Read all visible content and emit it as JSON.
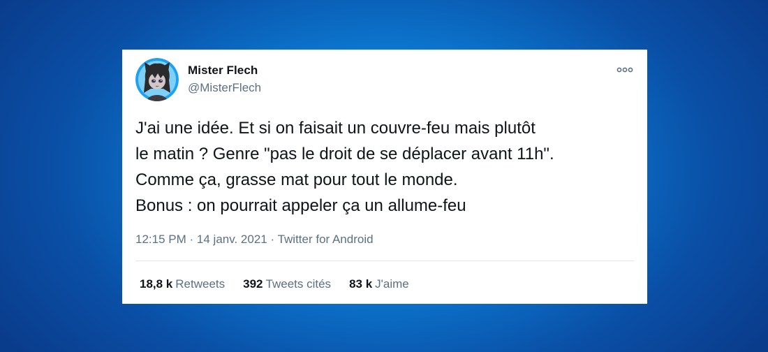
{
  "tweet": {
    "author_name": "Mister Flech",
    "author_handle": "@MisterFlech",
    "text": "J'ai une idée. Et si on faisait un couvre-feu mais plutôt\nle matin ? Genre \"pas le droit de se déplacer avant 11h\".\nComme ça, grasse mat pour tout le monde.\nBonus : on pourrait appeler ça un allume-feu",
    "time": "12:15 PM",
    "separator": "·",
    "date": "14 janv. 2021",
    "source": "Twitter for Android",
    "stats": [
      {
        "count": "18,8 k",
        "label": "Retweets"
      },
      {
        "count": "392",
        "label": "Tweets cités"
      },
      {
        "count": "83 k",
        "label": "J'aime"
      }
    ]
  },
  "icons": {
    "more": "more-options-icon",
    "avatar": "avatar"
  },
  "colors": {
    "background": "#0c78d0",
    "card": "#ffffff",
    "text_primary": "#0f1419",
    "text_secondary": "#5b7083",
    "avatar_ring": "#1da1f2"
  }
}
